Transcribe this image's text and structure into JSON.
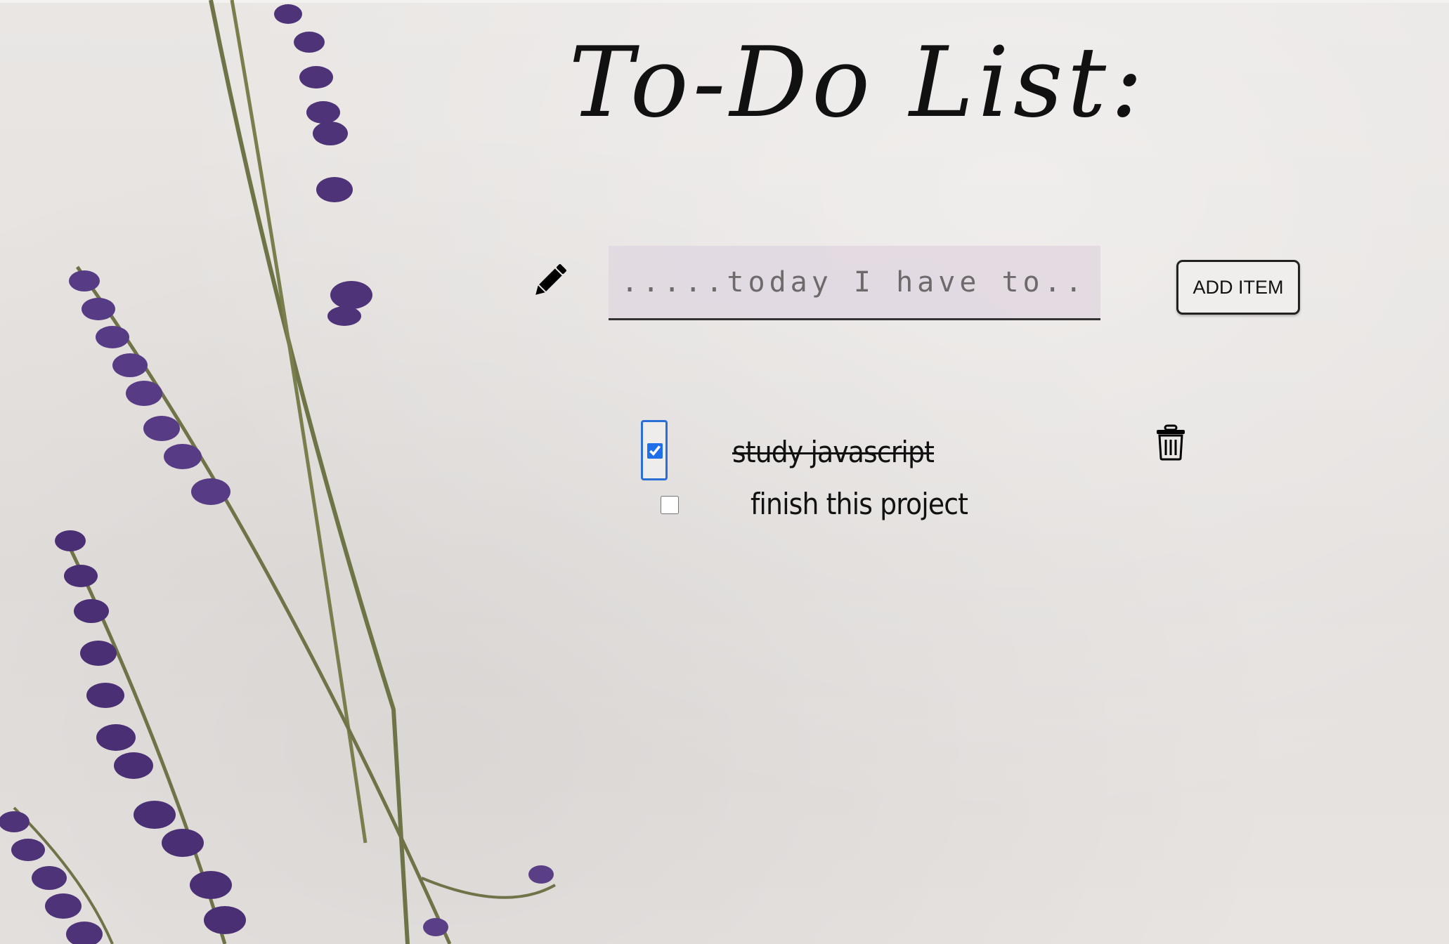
{
  "page": {
    "title": "To-Do List:"
  },
  "input": {
    "placeholder": ".....today I have to......",
    "value": ""
  },
  "add_button": {
    "label": "ADD ITEM"
  },
  "tasks": [
    {
      "text": "study javascript",
      "checked": true
    },
    {
      "text": "finish this project",
      "checked": false
    }
  ],
  "icons": {
    "pencil": "pencil-icon",
    "trash": "trash-icon"
  },
  "colors": {
    "background": "#e6e2e0",
    "input_bg": "#e1d7e1",
    "text": "#111111",
    "checkbox_focus": "#2b6fd6",
    "lavender": "#5b3f86"
  }
}
